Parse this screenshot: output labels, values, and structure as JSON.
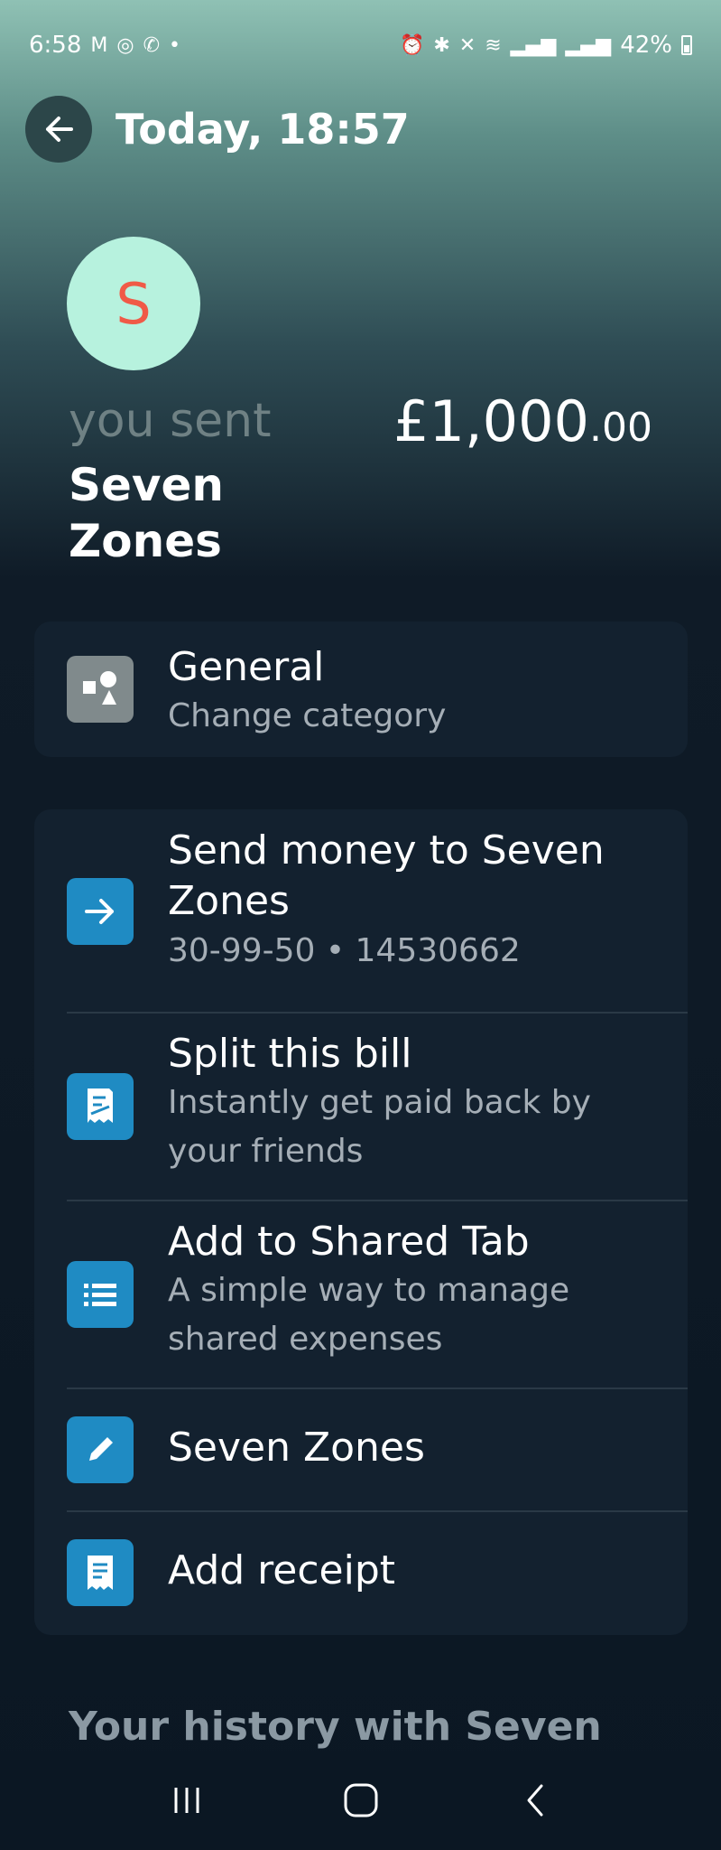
{
  "status_bar": {
    "time": "6:58",
    "notification_icons": [
      "gmail-icon",
      "instagram-icon",
      "whatsapp-icon",
      "dot-icon"
    ],
    "system_icons": [
      "alarm-icon",
      "bluetooth-icon",
      "mute-icon",
      "wifi-icon",
      "signal-icon",
      "volte-icon",
      "signal-icon"
    ],
    "battery": "42%",
    "battery_level": 0.42
  },
  "header": {
    "title": "Today, 18:57"
  },
  "transaction": {
    "avatar_letter": "S",
    "label": "you sent",
    "recipient": "Seven Zones",
    "amount_main": "£1,000",
    "amount_pence": ".00"
  },
  "category": {
    "title": "General",
    "subtitle": "Change category"
  },
  "actions": [
    {
      "title": "Send money to Seven Zones",
      "subtitle": "30-99-50 • 14530662",
      "icon": "arrow-right-icon"
    },
    {
      "title": "Split this bill",
      "subtitle": "Instantly get paid back by your friends",
      "icon": "split-bill-icon"
    },
    {
      "title": "Add to Shared Tab",
      "subtitle": "A simple way to manage shared expenses",
      "icon": "list-icon"
    },
    {
      "title": "Seven Zones",
      "subtitle": "",
      "icon": "pencil-icon"
    },
    {
      "title": "Add receipt",
      "subtitle": "",
      "icon": "receipt-icon"
    }
  ],
  "history": {
    "title": "Your history with Seven"
  },
  "colors": {
    "accent_blue": "#1f8bc3",
    "avatar_bg": "#b7f2de",
    "avatar_letter": "#f05a47",
    "card_bg": "#13212f"
  }
}
